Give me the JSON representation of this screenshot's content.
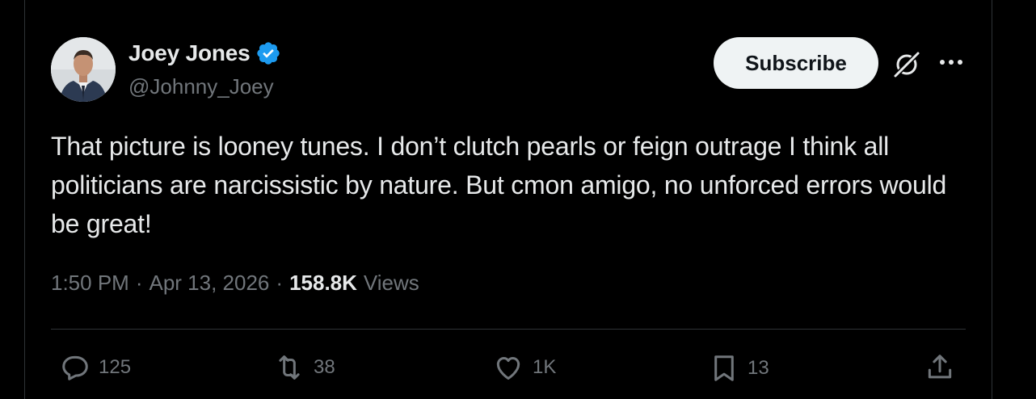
{
  "author": {
    "display_name": "Joey Jones",
    "handle": "@Johnny_Joey",
    "verified": true
  },
  "header": {
    "subscribe_label": "Subscribe",
    "grok_icon": "grok-icon",
    "more_icon": "more-icon"
  },
  "tweet": {
    "text": "That picture is looney tunes. I don’t clutch pearls or feign outrage I think all politicians are narcissistic by nature. But cmon amigo, no unforced errors would be great!",
    "time": "1:50 PM",
    "separator": "·",
    "date": "Apr 13, 2026",
    "views_count": "158.8K",
    "views_label": "Views"
  },
  "actions": {
    "replies": "125",
    "reposts": "38",
    "likes": "1K",
    "bookmarks": "13"
  },
  "colors": {
    "background": "#000000",
    "text": "#e7e9ea",
    "muted": "#71767b",
    "verified": "#1d9bf0",
    "divider": "#2f3336"
  }
}
